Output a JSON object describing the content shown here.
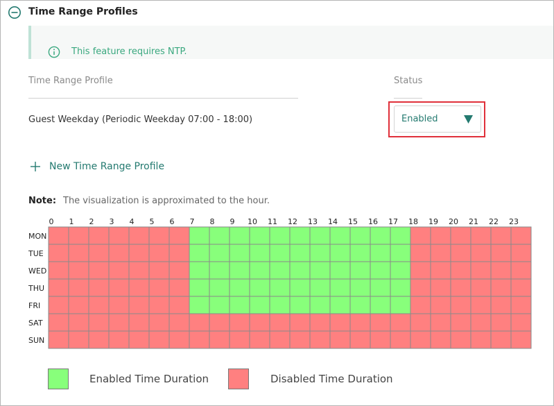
{
  "panel": {
    "title": "Time Range Profiles",
    "notice": "This feature requires NTP."
  },
  "columns": {
    "profile": "Time Range Profile",
    "status": "Status"
  },
  "profiles": [
    {
      "name": "Guest Weekday (Periodic Weekday 07:00 - 18:00)",
      "status": "Enabled"
    }
  ],
  "actions": {
    "new_profile": "New Time Range Profile"
  },
  "note": {
    "label": "Note:",
    "text": "The visualization is approximated to the hour."
  },
  "schedule": {
    "hours": [
      "0",
      "1",
      "2",
      "3",
      "4",
      "5",
      "6",
      "7",
      "8",
      "9",
      "10",
      "11",
      "12",
      "13",
      "14",
      "15",
      "16",
      "17",
      "18",
      "19",
      "20",
      "21",
      "22",
      "23"
    ],
    "days": [
      {
        "label": "MON",
        "enabled_hours": [
          7,
          8,
          9,
          10,
          11,
          12,
          13,
          14,
          15,
          16,
          17
        ]
      },
      {
        "label": "TUE",
        "enabled_hours": [
          7,
          8,
          9,
          10,
          11,
          12,
          13,
          14,
          15,
          16,
          17
        ]
      },
      {
        "label": "WED",
        "enabled_hours": [
          7,
          8,
          9,
          10,
          11,
          12,
          13,
          14,
          15,
          16,
          17
        ]
      },
      {
        "label": "THU",
        "enabled_hours": [
          7,
          8,
          9,
          10,
          11,
          12,
          13,
          14,
          15,
          16,
          17
        ]
      },
      {
        "label": "FRI",
        "enabled_hours": [
          7,
          8,
          9,
          10,
          11,
          12,
          13,
          14,
          15,
          16,
          17
        ]
      },
      {
        "label": "SAT",
        "enabled_hours": []
      },
      {
        "label": "SUN",
        "enabled_hours": []
      }
    ],
    "colors": {
      "enabled": "#88ff7b",
      "disabled": "#ff8080",
      "grid": "#8a8a8a"
    }
  },
  "legend": {
    "enabled": "Enabled Time Duration",
    "disabled": "Disabled Time Duration"
  },
  "icons": {
    "collapse": "minus-circle-icon",
    "info": "info-circle-icon",
    "dropdown": "caret-down-icon",
    "add": "plus-icon"
  },
  "colors": {
    "accent": "#247a70",
    "notice_text": "#3aa87f",
    "highlight": "#e0303a"
  }
}
